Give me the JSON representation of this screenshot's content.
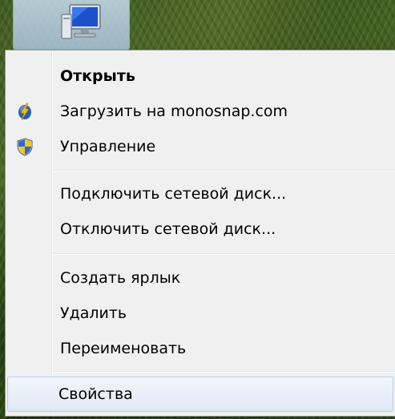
{
  "menu": {
    "items": [
      {
        "label": "Открыть",
        "bold": true,
        "icon": null
      },
      {
        "label": "Загрузить на monosnap.com",
        "bold": false,
        "icon": "monosnap-lightning-icon"
      },
      {
        "label": "Управление",
        "bold": false,
        "icon": "uac-shield-icon"
      },
      {
        "label": "Подключить сетевой диск...",
        "bold": false,
        "icon": null
      },
      {
        "label": "Отключить сетевой диск...",
        "bold": false,
        "icon": null
      },
      {
        "label": "Создать ярлык",
        "bold": false,
        "icon": null
      },
      {
        "label": "Удалить",
        "bold": false,
        "icon": null
      },
      {
        "label": "Переименовать",
        "bold": false,
        "icon": null
      },
      {
        "label": "Свойства",
        "bold": false,
        "icon": null,
        "highlighted": true
      }
    ]
  },
  "desktop": {
    "icon": "computer-icon",
    "icon_selected": true
  }
}
